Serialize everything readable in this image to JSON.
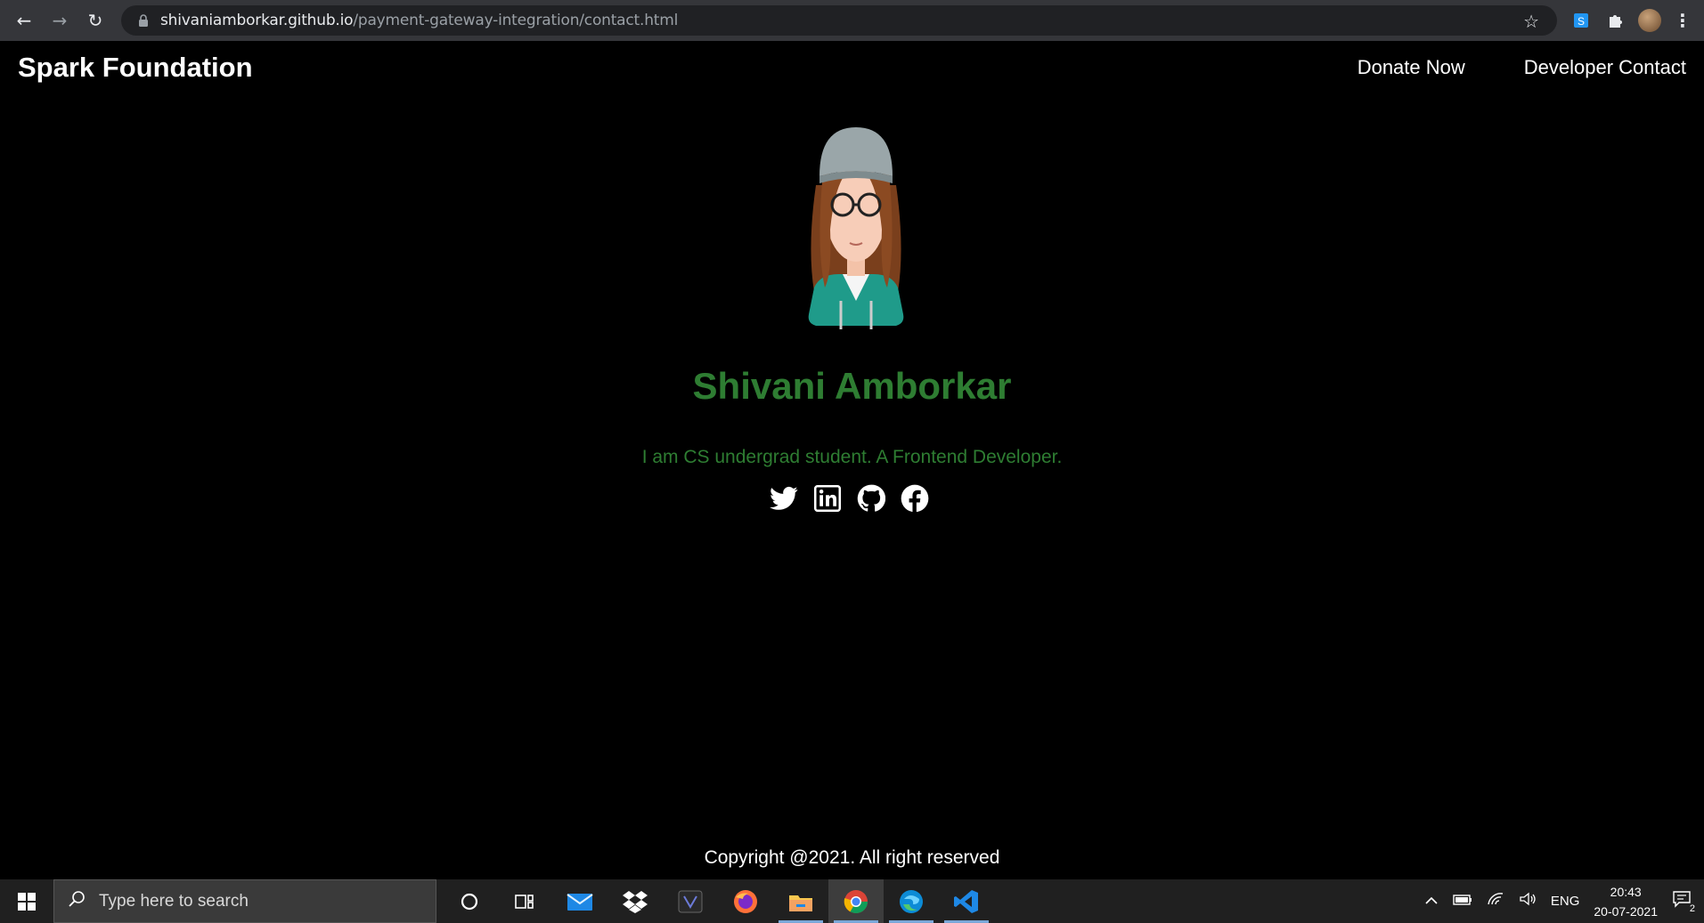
{
  "browser": {
    "url_domain": "shivaniamborkar.github.io",
    "url_path": "/payment-gateway-integration/contact.html"
  },
  "site": {
    "brand": "Spark Foundation",
    "nav": [
      {
        "label": "Donate Now"
      },
      {
        "label": "Developer Contact"
      }
    ]
  },
  "profile": {
    "name": "Shivani Amborkar",
    "bio": "I am CS undergrad student. A Frontend Developer.",
    "socials": [
      "twitter-icon",
      "linkedin-icon",
      "github-icon",
      "facebook-icon"
    ]
  },
  "footer": {
    "copyright": "Copyright @2021. All right reserved"
  },
  "taskbar": {
    "search_placeholder": "Type here to search",
    "apps": [
      "cortana-icon",
      "task-view-icon",
      "mail-icon",
      "dropbox-icon",
      "predator-icon",
      "firefox-icon",
      "file-explorer-icon",
      "chrome-icon",
      "edge-icon",
      "vscode-icon"
    ],
    "tray": {
      "language": "ENG",
      "time": "20:43",
      "date": "20-07-2021",
      "notification_count": "2"
    }
  },
  "colors": {
    "accent_green": "#2e7d32",
    "background": "#000000",
    "browser_bar": "#35363a",
    "taskbar": "#202020"
  }
}
